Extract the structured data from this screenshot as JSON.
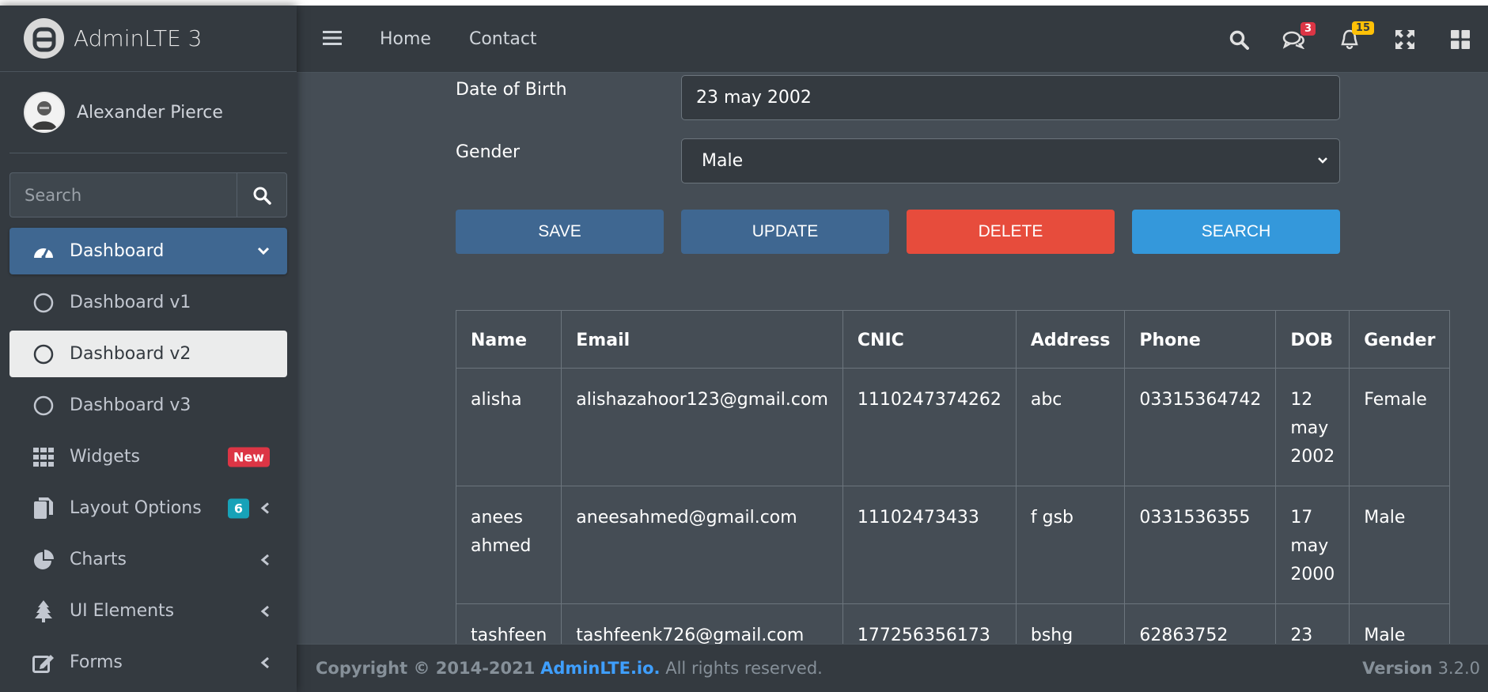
{
  "brand": {
    "name": "AdminLTE 3"
  },
  "user": {
    "name": "Alexander Pierce"
  },
  "sidebar_search": {
    "placeholder": "Search"
  },
  "nav": {
    "dashboard": "Dashboard",
    "dashboard_v1": "Dashboard v1",
    "dashboard_v2": "Dashboard v2",
    "dashboard_v3": "Dashboard v3",
    "widgets": "Widgets",
    "widgets_badge": "New",
    "layout_options": "Layout Options",
    "layout_badge": "6",
    "charts": "Charts",
    "ui_elements": "UI Elements",
    "forms": "Forms"
  },
  "topbar": {
    "home": "Home",
    "contact": "Contact",
    "messages_count": "3",
    "notifications_count": "15"
  },
  "form": {
    "dob_label": "Date of Birth",
    "dob_value": "23 may 2002",
    "gender_label": "Gender",
    "gender_value": "Male"
  },
  "buttons": {
    "save": "SAVE",
    "update": "UPDATE",
    "delete": "DELETE",
    "search": "SEARCH"
  },
  "table": {
    "headers": [
      "Name",
      "Email",
      "CNIC",
      "Address",
      "Phone",
      "DOB",
      "Gender"
    ],
    "rows": [
      [
        "alisha",
        "alishazahoor123@gmail.com",
        "1110247374262",
        "abc",
        "03315364742",
        "12 may 2002",
        "Female"
      ],
      [
        "anees ahmed",
        "aneesahmed@gmail.com",
        "11102473433",
        "f gsb",
        "0331536355",
        "17 may 2000",
        "Male"
      ],
      [
        "tashfeen",
        "tashfeenk726@gmail.com",
        "177256356173",
        "bshg",
        "62863752",
        "23",
        "Male"
      ]
    ]
  },
  "footer": {
    "copyright_prefix": "Copyright © 2014-2021",
    "link": "AdminLTE.io.",
    "suffix": "All rights reserved.",
    "version_label": "Version",
    "version": "3.2.0"
  },
  "colors": {
    "sidebar_bg": "#343a40",
    "content_bg": "#454d55",
    "primary": "#3f6791",
    "danger": "#e74c3c",
    "info": "#3498db"
  }
}
